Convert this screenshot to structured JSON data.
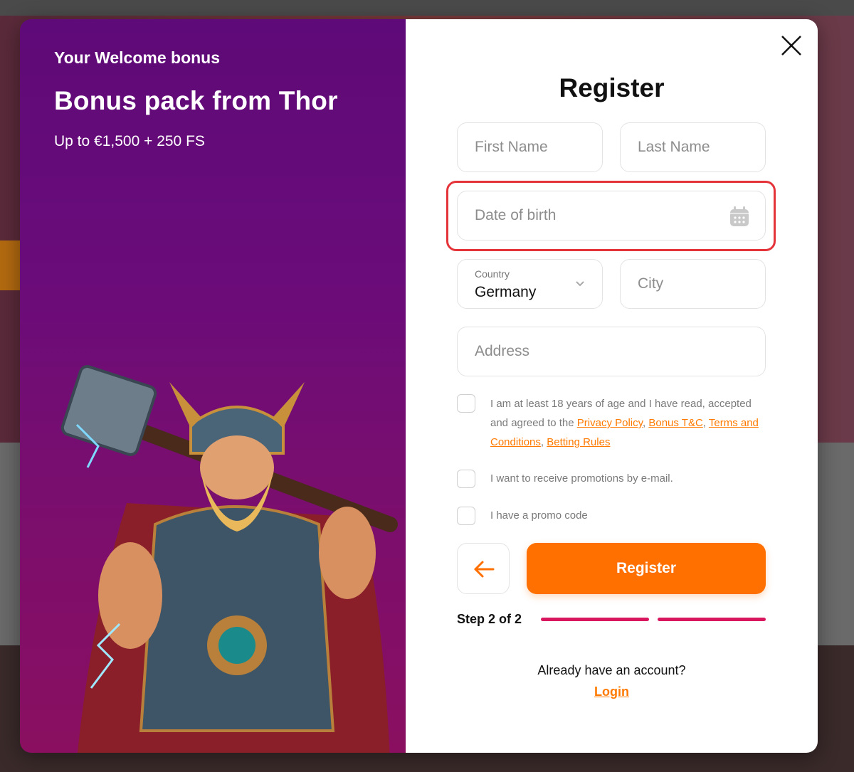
{
  "promo": {
    "eyebrow": "Your Welcome bonus",
    "headline": "Bonus pack from Thor",
    "offer": "Up to €1,500 + 250 FS"
  },
  "form": {
    "title": "Register",
    "first_name_placeholder": "First Name",
    "last_name_placeholder": "Last Name",
    "dob_placeholder": "Date of birth",
    "country_label": "Country",
    "country_value": "Germany",
    "city_placeholder": "City",
    "address_placeholder": "Address",
    "terms_prefix": "I am at least 18 years of age and I have read, accepted and agreed to the ",
    "privacy_link": "Privacy Policy",
    "bonus_link": "Bonus T&C",
    "terms_link": "Terms and Conditions",
    "betting_link": "Betting Rules",
    "promotions_label": "I want to receive promotions by e-mail.",
    "promo_code_label": "I have a promo code",
    "register_label": "Register",
    "step_label": "Step 2 of 2",
    "already_text": "Already have an account?",
    "login_label": "Login"
  },
  "colors": {
    "accent": "#ff7000",
    "progress": "#d8175f",
    "highlight": "#e5333a"
  },
  "icons": {
    "close": "close-icon",
    "calendar": "calendar-icon",
    "chevron": "chevron-down-icon",
    "back": "arrow-left-icon"
  }
}
